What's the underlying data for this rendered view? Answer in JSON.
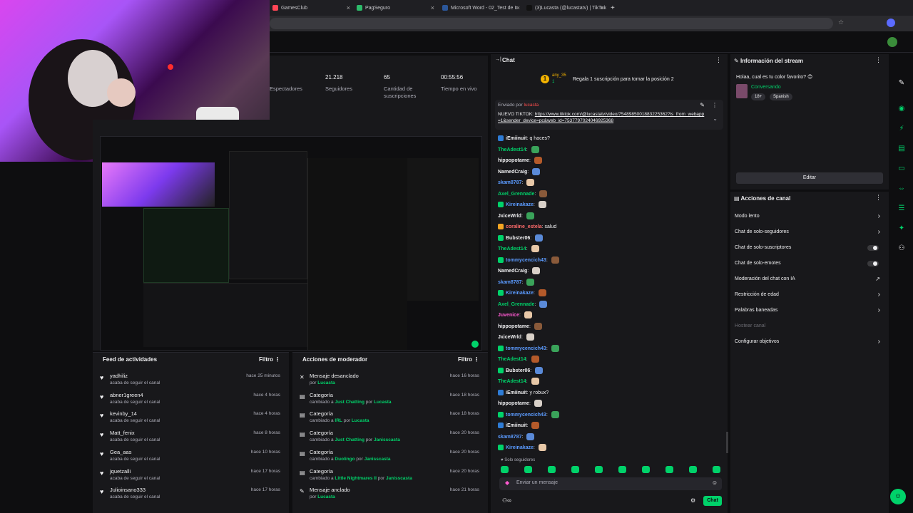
{
  "browser": {
    "tabs": [
      {
        "label": "GamesClub",
        "color": "#ff4655"
      },
      {
        "label": "PagSeguro",
        "color": "#2dbb6a"
      },
      {
        "label": "Microsoft Word - 02_Test de Ir",
        "color": "#2b579a"
      },
      {
        "label": "(3)Lucasta (@lucastatv) | TikTok",
        "color": "#111111"
      }
    ],
    "new_tab": "+"
  },
  "stats": {
    "items": [
      {
        "value": "",
        "label": "Espectadores"
      },
      {
        "value": "21.218",
        "label": "Seguidores"
      },
      {
        "value": "65",
        "label": "Cantidad de suscripciones"
      },
      {
        "value": "00:55:56",
        "label": "Tiempo en vivo"
      }
    ]
  },
  "feed": {
    "title": "Feed de actividades",
    "filter": "Filtro",
    "rows": [
      {
        "name": "yadhiliz",
        "sub": "acaba de seguir el canal",
        "time": "hace 25 minutos"
      },
      {
        "name": "abner1green4",
        "sub": "acaba de seguir el canal",
        "time": "hace 4 horas"
      },
      {
        "name": "kevinby_14",
        "sub": "acaba de seguir el canal",
        "time": "hace 4 horas"
      },
      {
        "name": "Matt_fenix",
        "sub": "acaba de seguir el canal",
        "time": "hace 8 horas"
      },
      {
        "name": "Gea_aas",
        "sub": "acaba de seguir el canal",
        "time": "hace 10 horas"
      },
      {
        "name": "jquetzalli",
        "sub": "acaba de seguir el canal",
        "time": "hace 17 horas"
      },
      {
        "name": "Julioinsano333",
        "sub": "acaba de seguir el canal",
        "time": "hace 17 horas"
      }
    ]
  },
  "mod": {
    "title": "Acciones de moderador",
    "filter": "Filtro",
    "rows": [
      {
        "icon": "✕",
        "name": "Mensaje desanclado",
        "pre": "por ",
        "a": "Lucasta",
        "mid": "",
        "b": "",
        "time": "hace 16 horas"
      },
      {
        "icon": "▤",
        "name": "Categoría",
        "pre": "cambiado a ",
        "a": "Just Chatting",
        "mid": " por ",
        "b": "Lucasta",
        "time": "hace 18 horas"
      },
      {
        "icon": "▤",
        "name": "Categoría",
        "pre": "cambiado a ",
        "a": "IRL",
        "mid": " por ",
        "b": "Lucasta",
        "time": "hace 18 horas"
      },
      {
        "icon": "▤",
        "name": "Categoría",
        "pre": "cambiado a ",
        "a": "Just Chatting",
        "mid": " por ",
        "b": "Janisscasta",
        "time": "hace 20 horas"
      },
      {
        "icon": "▤",
        "name": "Categoría",
        "pre": "cambiado a ",
        "a": "Duolingo",
        "mid": " por ",
        "b": "Janisscasta",
        "time": "hace 20 horas"
      },
      {
        "icon": "▤",
        "name": "Categoría",
        "pre": "cambiado a ",
        "a": "Little Nightmares II",
        "mid": " por ",
        "b": "Janisscasta",
        "time": "hace 20 horas"
      },
      {
        "icon": "✎",
        "name": "Mensaje anclado",
        "pre": "por ",
        "a": "Lucasta",
        "mid": "",
        "b": "",
        "time": "hace 21 horas"
      }
    ]
  },
  "chat": {
    "title": "Chat",
    "hype_user": "any_35",
    "hype_count": "1",
    "hype_text": "Regala 1 suscripción para tomar la posición 2",
    "pinned_by": "Enviado por",
    "pinned_author": "lucasta",
    "pinned_prefix": "NUEVO TIKTOK: ",
    "pinned_link": "https://www.tiktok.com/@lucastatv/video/7548985001883225362?is_from_webapp=1&sender_device=pc&web_id=7537797024046925368",
    "messages": [
      {
        "user": "iEmiinuit",
        "color": "#efeff1",
        "text": "q haces?",
        "emote": false,
        "badge": "#2e7cd6"
      },
      {
        "user": "TheAdest14",
        "color": "#00d26a",
        "text": "",
        "emote": true,
        "badge": ""
      },
      {
        "user": "hippopotame",
        "color": "#efeff1",
        "text": "",
        "emote": true,
        "badge": ""
      },
      {
        "user": "NamedCraig",
        "color": "#efeff1",
        "text": "",
        "emote": true,
        "badge": ""
      },
      {
        "user": "skam8787",
        "color": "#5b9bff",
        "text": "",
        "emote": true,
        "badge": ""
      },
      {
        "user": "Axel_Grennade",
        "color": "#00d26a",
        "text": "",
        "emote": true,
        "badge": ""
      },
      {
        "user": "Kireinakaze",
        "color": "#5b9bff",
        "text": "",
        "emote": true,
        "badge": "#00d26a"
      },
      {
        "user": "JxiceWrld",
        "color": "#efeff1",
        "text": "",
        "emote": true,
        "badge": ""
      },
      {
        "user": "coraline_estela",
        "color": "#ff6b6b",
        "text": "salud",
        "emote": false,
        "badge": "#f5a623"
      },
      {
        "user": "Bubster06",
        "color": "#efeff1",
        "text": "",
        "emote": true,
        "badge": "#00d26a"
      },
      {
        "user": "TheAdest14",
        "color": "#00d26a",
        "text": "",
        "emote": true,
        "badge": ""
      },
      {
        "user": "tommycencich43",
        "color": "#5b9bff",
        "text": "",
        "emote": true,
        "badge": "#00d26a"
      },
      {
        "user": "NamedCraig",
        "color": "#efeff1",
        "text": "",
        "emote": true,
        "badge": ""
      },
      {
        "user": "skam8787",
        "color": "#5b9bff",
        "text": "",
        "emote": true,
        "badge": ""
      },
      {
        "user": "Kireinakaze",
        "color": "#5b9bff",
        "text": "",
        "emote": true,
        "badge": "#00d26a"
      },
      {
        "user": "Axel_Grennade",
        "color": "#00d26a",
        "text": "",
        "emote": true,
        "badge": ""
      },
      {
        "user": "Juvenice",
        "color": "#ff5ad1",
        "text": "",
        "emote": true,
        "badge": ""
      },
      {
        "user": "hippopotame",
        "color": "#efeff1",
        "text": "",
        "emote": true,
        "badge": ""
      },
      {
        "user": "JxiceWrld",
        "color": "#efeff1",
        "text": "",
        "emote": true,
        "badge": ""
      },
      {
        "user": "tommycencich43",
        "color": "#5b9bff",
        "text": "",
        "emote": true,
        "badge": "#00d26a"
      },
      {
        "user": "TheAdest14",
        "color": "#00d26a",
        "text": "",
        "emote": true,
        "badge": ""
      },
      {
        "user": "Bubster06",
        "color": "#efeff1",
        "text": "",
        "emote": true,
        "badge": "#00d26a"
      },
      {
        "user": "TheAdest14",
        "color": "#00d26a",
        "text": "",
        "emote": true,
        "badge": ""
      },
      {
        "user": "iEmiinuit",
        "color": "#efeff1",
        "text": "y robux?",
        "emote": false,
        "badge": "#2e7cd6"
      },
      {
        "user": "hippopotame",
        "color": "#efeff1",
        "text": "",
        "emote": true,
        "badge": ""
      },
      {
        "user": "tommycencich43",
        "color": "#5b9bff",
        "text": "",
        "emote": true,
        "badge": "#00d26a"
      },
      {
        "user": "iEmiinuit",
        "color": "#efeff1",
        "text": "",
        "emote": true,
        "badge": "#2e7cd6"
      },
      {
        "user": "skam8787",
        "color": "#5b9bff",
        "text": "",
        "emote": true,
        "badge": ""
      },
      {
        "user": "Kireinakaze",
        "color": "#5b9bff",
        "text": "",
        "emote": true,
        "badge": "#00d26a"
      }
    ],
    "followers_only": "Solo seguidores",
    "input_placeholder": "Enviar un mensaje",
    "send_label": "Chat"
  },
  "info": {
    "title": "Información del stream",
    "stream_title": "Holaa, cual es tu color favorito? 😊",
    "category": "Conversando",
    "tags": [
      "18+",
      "Spanish"
    ],
    "edit_label": "Editar"
  },
  "actions": {
    "title": "Acciones de canal",
    "rows": [
      {
        "label": "Modo lento",
        "kind": "chev"
      },
      {
        "label": "Chat de solo-seguidores",
        "kind": "chev"
      },
      {
        "label": "Chat de solo-suscriptores",
        "kind": "toggle"
      },
      {
        "label": "Chat de solo-emotes",
        "kind": "toggle"
      },
      {
        "label": "Moderación del chat con IA",
        "kind": "ext"
      },
      {
        "label": "Restricción de edad",
        "kind": "chev"
      },
      {
        "label": "Palabras baneadas",
        "kind": "chev"
      },
      {
        "label": "Hostear canal",
        "kind": "disabled"
      },
      {
        "label": "Configurar objetivos",
        "kind": "chev"
      }
    ]
  },
  "colors": {
    "accent": "#00d26a",
    "bg": "#0e0e10",
    "panel": "#18181b"
  }
}
